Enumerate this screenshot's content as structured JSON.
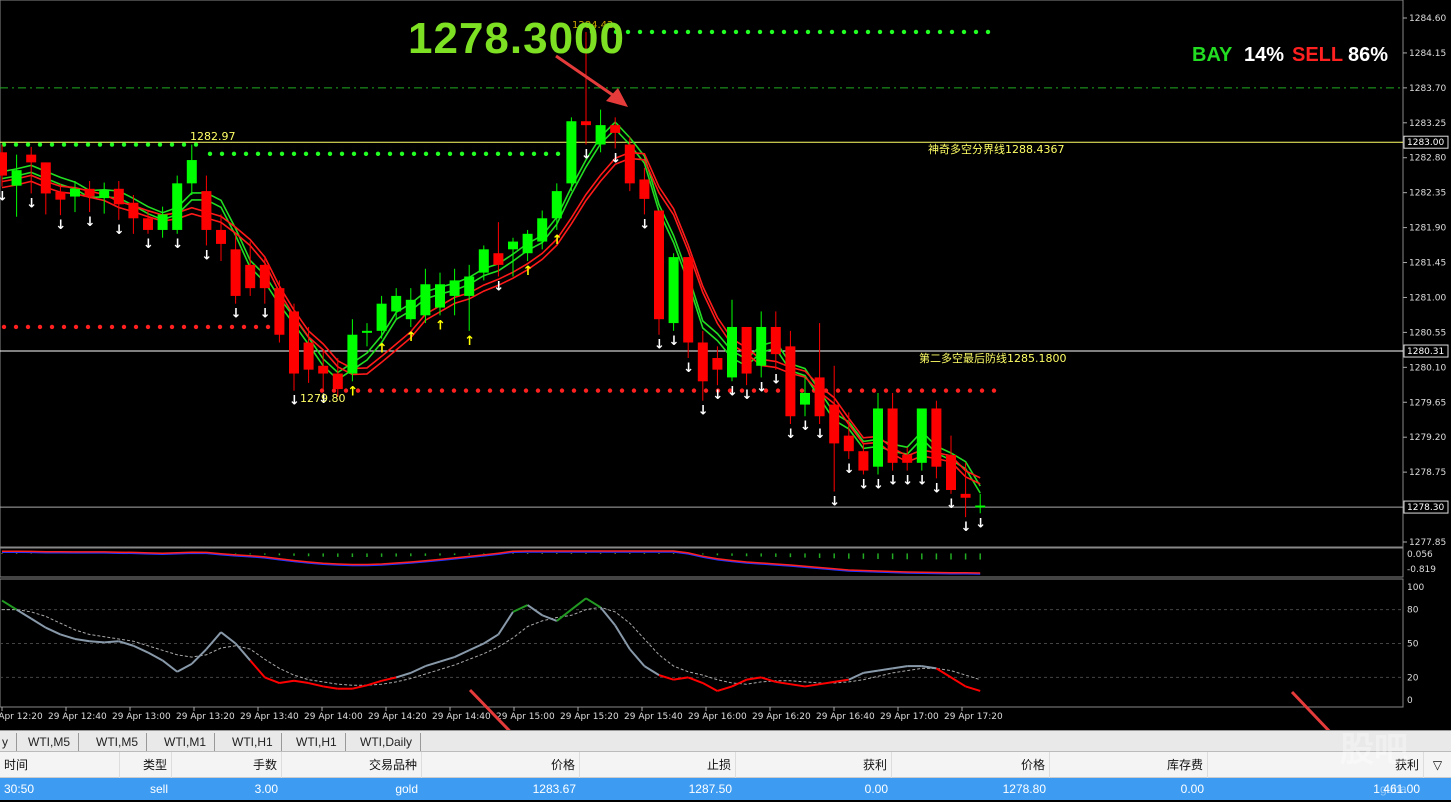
{
  "overlay": {
    "big_price": "1278.3000",
    "bay_label": "BAY",
    "bay_value": "14%",
    "sell_label": "SELL",
    "sell_value": "86%"
  },
  "chart_labels": {
    "high_marker": "1284.42",
    "level_high": "1282.97",
    "level_low": "1279.80",
    "line_upper_label": "神奇多空分界线1288.4367",
    "line_lower_label": "第二多空最后防线1285.1800"
  },
  "price_axis": {
    "ticks": [
      "1284.60",
      "1284.15",
      "1283.70",
      "1283.25",
      "1282.80",
      "1282.35",
      "1281.90",
      "1281.45",
      "1281.00",
      "1280.55",
      "1280.10",
      "1279.65",
      "1279.20",
      "1278.75",
      "1278.30",
      "1277.85"
    ],
    "tags": [
      "1283.00",
      "1280.31",
      "1278.30"
    ]
  },
  "macd_axis": {
    "ticks": [
      "0.056",
      "-0.819"
    ]
  },
  "stoch_axis": {
    "ticks": [
      "100",
      "80",
      "50",
      "20",
      "0"
    ]
  },
  "time_axis": {
    "ticks": [
      "29 Apr 12:20",
      "29 Apr 12:40",
      "29 Apr 13:00",
      "29 Apr 13:20",
      "29 Apr 13:40",
      "29 Apr 14:00",
      "29 Apr 14:20",
      "29 Apr 14:40",
      "29 Apr 15:00",
      "29 Apr 15:20",
      "29 Apr 15:40",
      "29 Apr 16:00",
      "29 Apr 16:20",
      "29 Apr 16:40",
      "29 Apr 17:00",
      "29 Apr 17:20"
    ]
  },
  "tabs": [
    "y",
    "WTI,M5",
    "WTI,M5",
    "WTI,M1",
    "WTI,H1",
    "WTI,H1",
    "WTI,Daily"
  ],
  "table": {
    "headers": [
      "时间",
      "类型",
      "手数",
      "交易品种",
      "价格",
      "止损",
      "获利",
      "价格",
      "库存费",
      "获利"
    ],
    "row": [
      "30:50",
      "sell",
      "3.00",
      "gold",
      "1283.67",
      "1287.50",
      "0.00",
      "1278.80",
      "0.00",
      "1 461.00"
    ]
  },
  "watermark": {
    "big": "股吧",
    "small": "guba"
  },
  "colors": {
    "bull": "#00ff00",
    "bear": "#ff0000",
    "band_green": "#22dd22",
    "band_red": "#ff1a1a",
    "level_line": "#ffff66",
    "dots_green": "#22ff22",
    "dots_red": "#ff2020",
    "row_highlight": "#3d9cf2",
    "arrow_up": "#ffff00",
    "arrow_down": "#ffffff"
  },
  "chart_data": {
    "type": "candlestick",
    "candles": [
      {
        "o": 1282.87,
        "h": 1282.97,
        "c": 1282.57,
        "l": 1282.43
      },
      {
        "o": 1282.44,
        "h": 1282.84,
        "c": 1282.64,
        "l": 1282.04
      },
      {
        "o": 1282.84,
        "h": 1282.94,
        "c": 1282.74,
        "l": 1282.34
      },
      {
        "o": 1282.74,
        "h": 1282.74,
        "c": 1282.34,
        "l": 1282.07
      },
      {
        "o": 1282.36,
        "h": 1282.46,
        "c": 1282.26,
        "l": 1282.06
      },
      {
        "o": 1282.3,
        "h": 1282.5,
        "c": 1282.4,
        "l": 1282.1
      },
      {
        "o": 1282.4,
        "h": 1282.5,
        "c": 1282.3,
        "l": 1282.1
      },
      {
        "o": 1282.28,
        "h": 1282.48,
        "c": 1282.38,
        "l": 1282.08
      },
      {
        "o": 1282.4,
        "h": 1282.5,
        "c": 1282.2,
        "l": 1282.0
      },
      {
        "o": 1282.22,
        "h": 1282.32,
        "c": 1282.02,
        "l": 1281.82
      },
      {
        "o": 1282.02,
        "h": 1282.12,
        "c": 1281.87,
        "l": 1281.82
      },
      {
        "o": 1281.87,
        "h": 1282.17,
        "c": 1282.07,
        "l": 1281.77
      },
      {
        "o": 1281.87,
        "h": 1282.57,
        "c": 1282.47,
        "l": 1281.82
      },
      {
        "o": 1282.47,
        "h": 1282.97,
        "c": 1282.77,
        "l": 1282.32
      },
      {
        "o": 1282.37,
        "h": 1282.57,
        "c": 1281.87,
        "l": 1281.67
      },
      {
        "o": 1281.87,
        "h": 1282.07,
        "c": 1281.69,
        "l": 1281.47
      },
      {
        "o": 1281.62,
        "h": 1281.82,
        "c": 1281.02,
        "l": 1280.92
      },
      {
        "o": 1281.42,
        "h": 1281.72,
        "c": 1281.12,
        "l": 1281.02
      },
      {
        "o": 1281.42,
        "h": 1281.52,
        "c": 1281.12,
        "l": 1280.92
      },
      {
        "o": 1281.12,
        "h": 1281.22,
        "c": 1280.52,
        "l": 1280.42
      },
      {
        "o": 1280.82,
        "h": 1280.92,
        "c": 1280.02,
        "l": 1279.8
      },
      {
        "o": 1280.42,
        "h": 1280.62,
        "c": 1280.07,
        "l": 1279.9
      },
      {
        "o": 1280.12,
        "h": 1280.32,
        "c": 1280.02,
        "l": 1279.82
      },
      {
        "o": 1280.02,
        "h": 1280.22,
        "c": 1279.82,
        "l": 1279.72
      },
      {
        "o": 1280.02,
        "h": 1280.72,
        "c": 1280.52,
        "l": 1279.92
      },
      {
        "o": 1280.57,
        "h": 1280.67,
        "c": 1280.57,
        "l": 1280.37
      },
      {
        "o": 1280.57,
        "h": 1281.02,
        "c": 1280.92,
        "l": 1280.47
      },
      {
        "o": 1280.82,
        "h": 1281.12,
        "c": 1281.02,
        "l": 1280.72
      },
      {
        "o": 1280.72,
        "h": 1281.12,
        "c": 1280.97,
        "l": 1280.62
      },
      {
        "o": 1280.77,
        "h": 1281.37,
        "c": 1281.17,
        "l": 1280.67
      },
      {
        "o": 1280.87,
        "h": 1281.32,
        "c": 1281.17,
        "l": 1280.77
      },
      {
        "o": 1281.02,
        "h": 1281.37,
        "c": 1281.22,
        "l": 1280.77
      },
      {
        "o": 1281.02,
        "h": 1281.42,
        "c": 1281.27,
        "l": 1280.57
      },
      {
        "o": 1281.32,
        "h": 1281.67,
        "c": 1281.62,
        "l": 1281.22
      },
      {
        "o": 1281.57,
        "h": 1281.97,
        "c": 1281.42,
        "l": 1281.27
      },
      {
        "o": 1281.62,
        "h": 1281.77,
        "c": 1281.72,
        "l": 1281.27
      },
      {
        "o": 1281.57,
        "h": 1281.87,
        "c": 1281.82,
        "l": 1281.47
      },
      {
        "o": 1281.72,
        "h": 1282.12,
        "c": 1282.02,
        "l": 1281.62
      },
      {
        "o": 1282.02,
        "h": 1282.47,
        "c": 1282.37,
        "l": 1281.87
      },
      {
        "o": 1282.47,
        "h": 1283.32,
        "c": 1283.27,
        "l": 1282.37
      },
      {
        "o": 1283.27,
        "h": 1284.42,
        "c": 1283.22,
        "l": 1282.97
      },
      {
        "o": 1282.97,
        "h": 1283.42,
        "c": 1283.22,
        "l": 1282.87
      },
      {
        "o": 1283.22,
        "h": 1283.32,
        "c": 1283.12,
        "l": 1282.92
      },
      {
        "o": 1282.97,
        "h": 1283.07,
        "c": 1282.47,
        "l": 1282.37
      },
      {
        "o": 1282.52,
        "h": 1282.67,
        "c": 1282.27,
        "l": 1282.07
      },
      {
        "o": 1282.12,
        "h": 1282.12,
        "c": 1280.72,
        "l": 1280.52
      },
      {
        "o": 1280.67,
        "h": 1281.57,
        "c": 1281.52,
        "l": 1280.57
      },
      {
        "o": 1281.52,
        "h": 1281.52,
        "c": 1280.42,
        "l": 1280.22
      },
      {
        "o": 1280.42,
        "h": 1280.57,
        "c": 1279.92,
        "l": 1279.67
      },
      {
        "o": 1280.22,
        "h": 1280.37,
        "c": 1280.07,
        "l": 1279.87
      },
      {
        "o": 1279.97,
        "h": 1280.97,
        "c": 1280.62,
        "l": 1279.92
      },
      {
        "o": 1280.62,
        "h": 1280.62,
        "c": 1280.02,
        "l": 1279.87
      },
      {
        "o": 1280.12,
        "h": 1280.82,
        "c": 1280.62,
        "l": 1279.97
      },
      {
        "o": 1280.62,
        "h": 1280.82,
        "c": 1280.27,
        "l": 1280.07
      },
      {
        "o": 1280.37,
        "h": 1280.57,
        "c": 1279.47,
        "l": 1279.37
      },
      {
        "o": 1279.62,
        "h": 1279.97,
        "c": 1279.77,
        "l": 1279.47
      },
      {
        "o": 1279.97,
        "h": 1280.67,
        "c": 1279.47,
        "l": 1279.37
      },
      {
        "o": 1279.62,
        "h": 1280.12,
        "c": 1279.12,
        "l": 1278.5
      },
      {
        "o": 1279.22,
        "h": 1279.52,
        "c": 1279.02,
        "l": 1278.92
      },
      {
        "o": 1279.02,
        "h": 1279.12,
        "c": 1278.77,
        "l": 1278.72
      },
      {
        "o": 1278.82,
        "h": 1279.77,
        "c": 1279.57,
        "l": 1278.72
      },
      {
        "o": 1279.57,
        "h": 1279.77,
        "c": 1278.87,
        "l": 1278.77
      },
      {
        "o": 1278.97,
        "h": 1279.07,
        "c": 1278.87,
        "l": 1278.77
      },
      {
        "o": 1278.87,
        "h": 1279.57,
        "c": 1279.57,
        "l": 1278.77
      },
      {
        "o": 1279.57,
        "h": 1279.67,
        "c": 1278.82,
        "l": 1278.67
      },
      {
        "o": 1278.97,
        "h": 1279.22,
        "c": 1278.52,
        "l": 1278.47
      },
      {
        "o": 1278.47,
        "h": 1278.87,
        "c": 1278.42,
        "l": 1278.17
      },
      {
        "o": 1278.32,
        "h": 1278.47,
        "c": 1278.32,
        "l": 1278.22
      }
    ],
    "ylim": [
      1277.85,
      1284.6
    ],
    "levels": [
      1283.0,
      1280.31,
      1278.3
    ],
    "stoch_main": [
      88,
      80,
      72,
      64,
      58,
      54,
      52,
      51,
      52,
      48,
      42,
      35,
      25,
      32,
      45,
      60,
      50,
      35,
      20,
      15,
      17,
      15,
      12,
      10,
      10,
      13,
      17,
      20,
      24,
      30,
      34,
      38,
      44,
      50,
      58,
      78,
      84,
      75,
      70,
      80,
      90,
      82,
      66,
      45,
      30,
      22,
      18,
      20,
      15,
      8,
      12,
      18,
      20,
      16,
      14,
      12,
      14,
      16,
      18,
      24,
      26,
      28,
      30,
      30,
      28,
      20,
      12,
      8
    ],
    "stoch_signal": [
      80,
      80,
      78,
      74,
      68,
      62,
      58,
      56,
      54,
      52,
      48,
      44,
      40,
      38,
      40,
      46,
      48,
      45,
      36,
      28,
      22,
      18,
      16,
      14,
      13,
      13,
      14,
      16,
      19,
      23,
      27,
      31,
      36,
      41,
      47,
      55,
      65,
      70,
      73,
      75,
      80,
      82,
      78,
      68,
      54,
      40,
      30,
      25,
      22,
      18,
      15,
      14,
      16,
      17,
      17,
      16,
      15,
      15,
      16,
      18,
      21,
      24,
      26,
      28,
      28,
      26,
      22,
      18
    ],
    "macd": [
      0.05,
      0.05,
      0.04,
      0.03,
      0.03,
      0.02,
      0.02,
      0.02,
      0.01,
      0.0,
      -0.02,
      -0.03,
      -0.01,
      0.01,
      0.0,
      -0.05,
      -0.1,
      -0.13,
      -0.18,
      -0.25,
      -0.32,
      -0.38,
      -0.43,
      -0.46,
      -0.48,
      -0.48,
      -0.46,
      -0.42,
      -0.38,
      -0.33,
      -0.28,
      -0.22,
      -0.16,
      -0.1,
      -0.03,
      0.05,
      0.15,
      0.25,
      0.32,
      0.4,
      0.5,
      0.55,
      0.55,
      0.5,
      0.4,
      0.25,
      0.12,
      -0.02,
      -0.15,
      -0.25,
      -0.32,
      -0.38,
      -0.42,
      -0.46,
      -0.5,
      -0.55,
      -0.6,
      -0.65,
      -0.7,
      -0.72,
      -0.74,
      -0.76,
      -0.78,
      -0.79,
      -0.8,
      -0.81,
      -0.81,
      -0.82
    ]
  }
}
